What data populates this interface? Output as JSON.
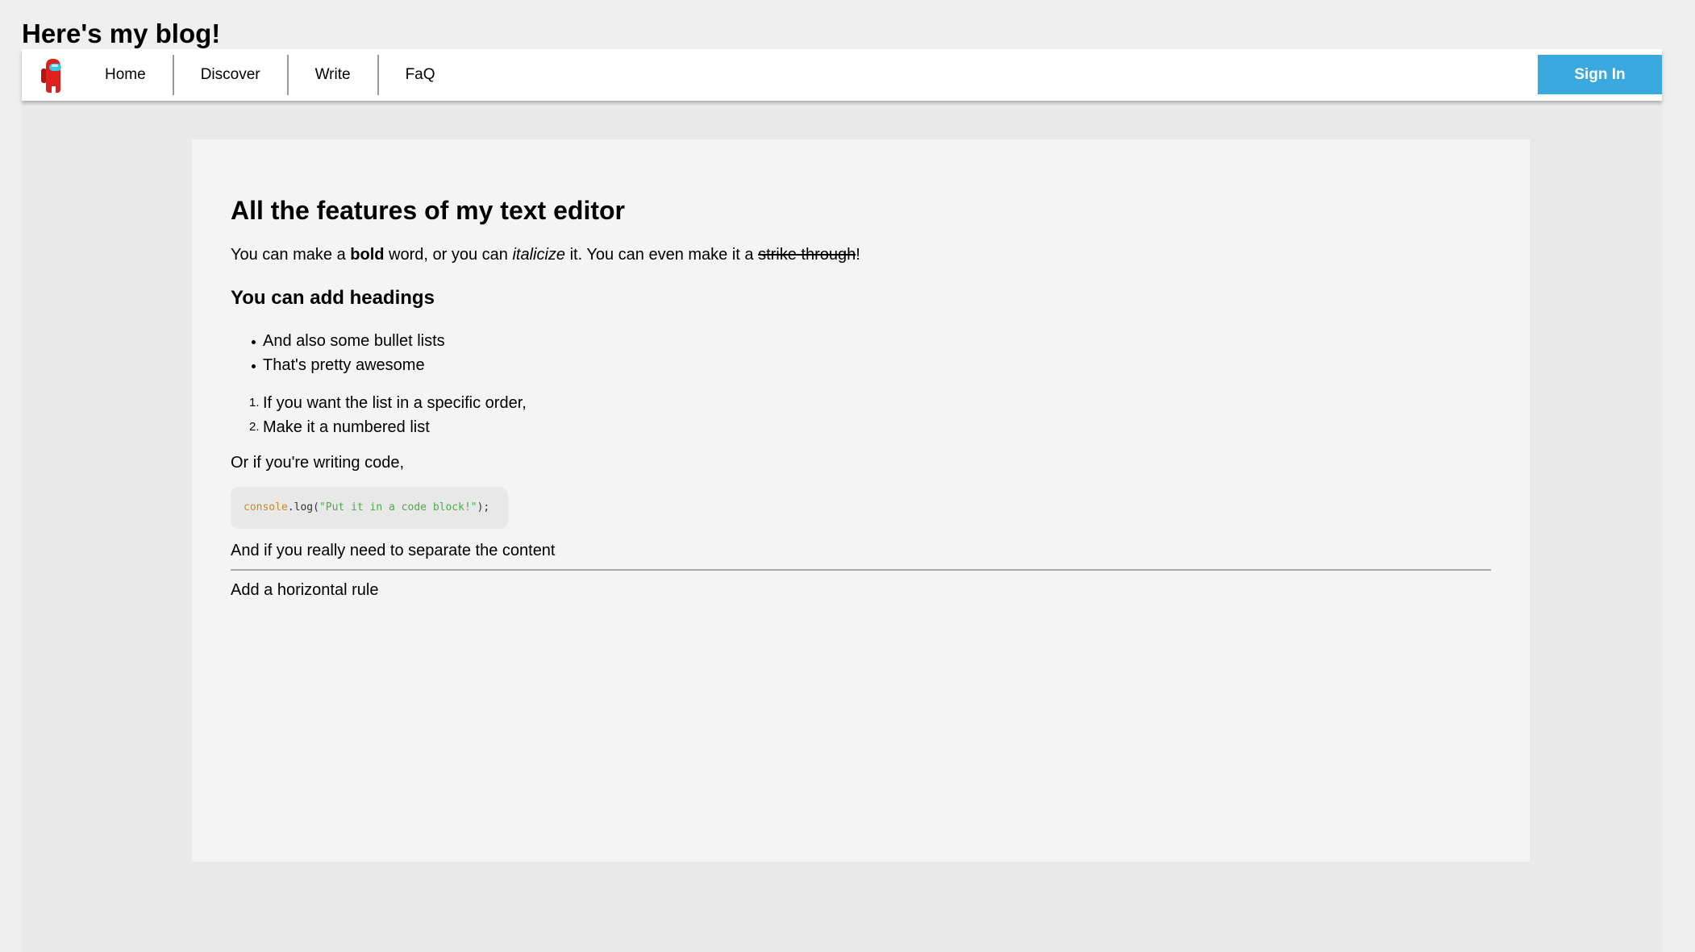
{
  "site": {
    "title": "Here's my blog!"
  },
  "nav": {
    "logo_icon": "crewmate-icon",
    "items": [
      {
        "label": "Home"
      },
      {
        "label": "Discover"
      },
      {
        "label": "Write"
      },
      {
        "label": "FaQ"
      }
    ],
    "signin_label": "Sign In"
  },
  "post": {
    "title": "All the features of my text editor",
    "intro": {
      "part1": "You can make a ",
      "bold": "bold",
      "part2": " word, or you can ",
      "italic": "italicize",
      "part3": " it. You can even make it a ",
      "strike": "strike through",
      "part4": "!"
    },
    "heading": "You can add headings",
    "bullets": [
      "And also some bullet lists",
      "That's pretty awesome"
    ],
    "numbered": [
      {
        "num": "1.",
        "text": "If you want the list in a specific order,"
      },
      {
        "num": "2.",
        "text": "Make it a numbered list"
      }
    ],
    "code_intro": "Or if you're writing code,",
    "code": {
      "object": "console",
      "method": ".log(",
      "string": "\"Put it in a code block!\"",
      "end": ");"
    },
    "separator_intro": "And if you really need to separate the content",
    "after_rule": "Add a horizontal rule"
  },
  "colors": {
    "signin_bg": "#3aa9e0",
    "logo_body": "#e0201c",
    "logo_visor": "#36c8e8",
    "code_object": "#c88a1e",
    "code_string": "#4caa4f"
  }
}
